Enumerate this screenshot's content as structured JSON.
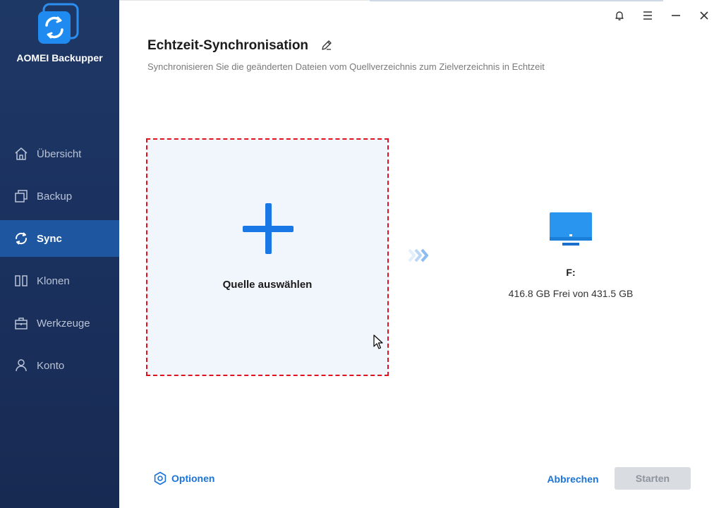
{
  "app": {
    "name": "AOMEI Backupper"
  },
  "sidebar": {
    "items": [
      {
        "label": "Übersicht",
        "icon": "home-icon",
        "active": false
      },
      {
        "label": "Backup",
        "icon": "backup-icon",
        "active": false
      },
      {
        "label": "Sync",
        "icon": "sync-icon",
        "active": true
      },
      {
        "label": "Klonen",
        "icon": "clone-icon",
        "active": false
      },
      {
        "label": "Werkzeuge",
        "icon": "toolbox-icon",
        "active": false
      },
      {
        "label": "Konto",
        "icon": "user-icon",
        "active": false
      }
    ]
  },
  "titlebar": {
    "icons": [
      "bell-icon",
      "menu-icon",
      "minimize-icon",
      "close-icon"
    ]
  },
  "header": {
    "title": "Echtzeit-Synchronisation",
    "subtitle": "Synchronisieren Sie die geänderten Dateien vom Quellverzeichnis zum Zielverzeichnis in Echtzeit"
  },
  "source": {
    "label": "Quelle auswählen"
  },
  "destination": {
    "drive": "F:",
    "space": "416.8 GB Frei von 431.5 GB"
  },
  "footer": {
    "options_label": "Optionen",
    "cancel_label": "Abbrechen",
    "start_label": "Starten"
  },
  "colors": {
    "accent": "#1a73d9",
    "sidebar": "#1b3260",
    "active": "#1e57a0",
    "dashed_border": "#e3101f"
  }
}
